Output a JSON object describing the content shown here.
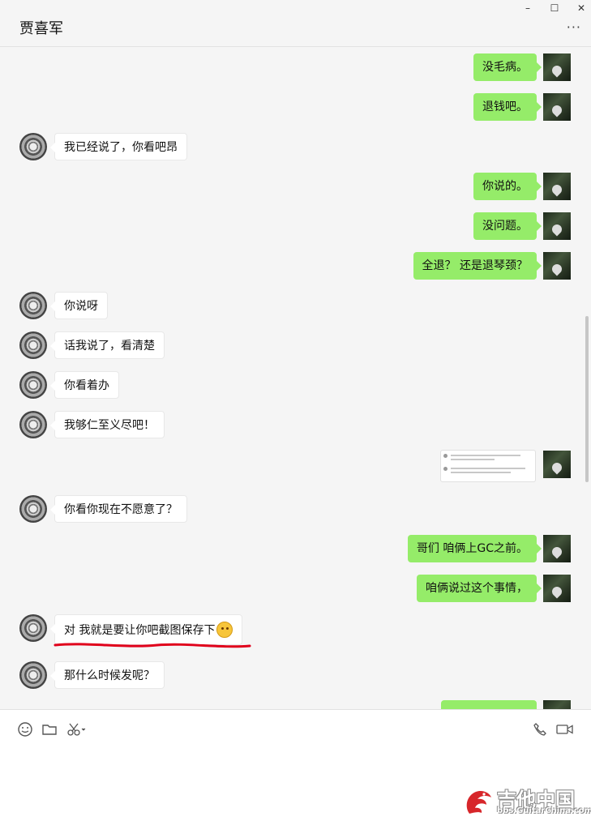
{
  "window": {
    "title": "贾喜军",
    "minimize": "–",
    "maximize": "☐",
    "close": "✕",
    "more": "···"
  },
  "messages": [
    {
      "side": "right",
      "text": "没毛病。"
    },
    {
      "side": "right",
      "text": "退钱吧。"
    },
    {
      "side": "left",
      "text": "我已经说了，你看吧昂"
    },
    {
      "side": "right",
      "text": "你说的。"
    },
    {
      "side": "right",
      "text": "没问题。"
    },
    {
      "side": "right",
      "text": "全退？ 还是退琴颈？"
    },
    {
      "side": "left",
      "text": "你说呀"
    },
    {
      "side": "left",
      "text": "话我说了，看清楚"
    },
    {
      "side": "left",
      "text": "你看着办"
    },
    {
      "side": "left",
      "text": "我够仁至义尽吧！"
    },
    {
      "side": "right",
      "type": "image"
    },
    {
      "side": "left",
      "text": "你看你现在不愿意了？"
    },
    {
      "side": "right",
      "text": "哥们 咱俩上GC之前。"
    },
    {
      "side": "right",
      "text": "咱俩说过这个事情，"
    },
    {
      "side": "left",
      "text": "对 我就是要让你吧截图保存下",
      "emoji": "thinking-emoji"
    },
    {
      "side": "left",
      "text": "那什么时候发呢？"
    },
    {
      "side": "right",
      "text": ""
    }
  ],
  "toolbar": {
    "icons": [
      "smiley-icon",
      "folder-icon",
      "scissors-icon",
      "phone-icon",
      "video-icon"
    ]
  },
  "watermark": {
    "title": "吉他中国",
    "url": "bbs.GuitarChina.com"
  },
  "colors": {
    "sent_bubble": "#95ec69",
    "received_bubble": "#ffffff",
    "chat_background": "#f5f5f5",
    "annotation_red": "#e0001b"
  }
}
